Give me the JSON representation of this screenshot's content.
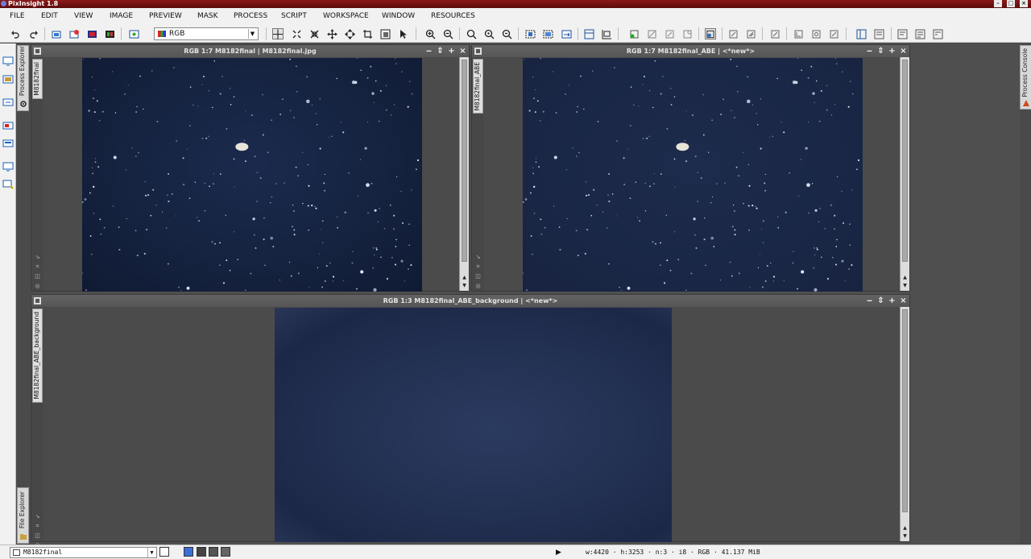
{
  "app": {
    "title": "PixInsight 1.8"
  },
  "window_controls": {
    "minimize": "–",
    "maximize": "□",
    "close": "×"
  },
  "menu": {
    "items": [
      "FILE",
      "EDIT",
      "VIEW",
      "IMAGE",
      "PREVIEW",
      "MASK",
      "PROCESS",
      "SCRIPT",
      "WORKSPACE",
      "WINDOW",
      "RESOURCES"
    ]
  },
  "toolbar": {
    "rgb_select_value": "RGB",
    "icons": [
      "undo-icon",
      "redo-icon",
      "new-image-icon",
      "open-icon",
      "save-icon",
      "screen-icon",
      "close-view-icon",
      "readout-mode-icon",
      "zoom-mode-icon",
      "pan-mode-icon",
      "center-icon",
      "move-icon",
      "crop-icon",
      "new-preview-icon",
      "select-icon",
      "zoom-in-icon",
      "zoom-out-icon",
      "zoom-fit-icon",
      "zoom-1-1-icon",
      "zoom-1-2-icon",
      "fit-view-icon",
      "fit-window-icon",
      "channel-icon",
      "histogram-icon",
      "statistics-icon",
      "stf-auto-icon",
      "stf-reset-icon",
      "stf-link-icon",
      "mask-show-icon",
      "mask-invert-icon",
      "mask-enable-icon",
      "previews-icon",
      "process-icon",
      "script-icon",
      "workspace-icon",
      "explorer-icon",
      "history-icon",
      "console-icon",
      "properties-icon",
      "format-icon",
      "info-icon"
    ]
  },
  "left_panel": {
    "process_explorer_label": "Process Explorer",
    "file_explorer_label": "File Explorer"
  },
  "right_panel": {
    "process_console_label": "Process Console"
  },
  "windows": [
    {
      "id": "M8182final",
      "title": "RGB 1:7 M8182final | M8182final.jpg",
      "tab_label": "M8182final"
    },
    {
      "id": "M8182final_ABE",
      "title": "RGB 1:7 M8182final_ABE | <*new*>",
      "tab_label": "M8182final_ABE"
    },
    {
      "id": "M8182final_ABE_background",
      "title": "RGB 1:3 M8182final_ABE_background | <*new*>",
      "tab_label": "M8182final_ABE_background"
    }
  ],
  "window_buttons": {
    "minimize": "‒",
    "shade": "⇕",
    "maximize": "+",
    "close": "×"
  },
  "bottom": {
    "active_view": "M8182final",
    "play_icon": "▶",
    "status": "w:4420 · h:3253 · n:3 · i8 · RGB · 41.137 MiB"
  }
}
